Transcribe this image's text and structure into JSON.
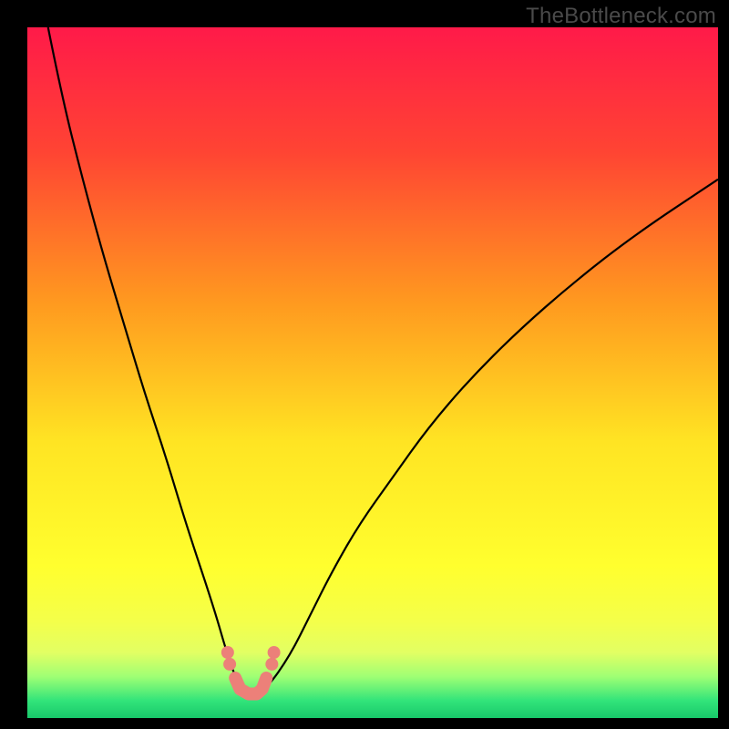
{
  "watermark": "TheBottleneck.com",
  "chart_data": {
    "type": "line",
    "title": "",
    "xlabel": "",
    "ylabel": "",
    "xlim": [
      0,
      100
    ],
    "ylim": [
      0,
      100
    ],
    "gradient_stops": [
      {
        "offset": 0,
        "color": "#ff1a49"
      },
      {
        "offset": 0.18,
        "color": "#ff4433"
      },
      {
        "offset": 0.4,
        "color": "#ff9a1f"
      },
      {
        "offset": 0.6,
        "color": "#ffe423"
      },
      {
        "offset": 0.78,
        "color": "#ffff2e"
      },
      {
        "offset": 0.86,
        "color": "#f4ff4a"
      },
      {
        "offset": 0.905,
        "color": "#e2ff63"
      },
      {
        "offset": 0.94,
        "color": "#9fff74"
      },
      {
        "offset": 0.975,
        "color": "#32e47a"
      },
      {
        "offset": 1.0,
        "color": "#18c86a"
      }
    ],
    "series": [
      {
        "name": "bottleneck-curve",
        "description": "Two-branch V curve; x is relative scale 0-100, y is bottleneck %",
        "x": [
          3,
          5,
          8,
          11,
          14,
          17,
          20,
          23,
          27,
          29,
          30.8,
          32.5,
          34.6,
          38,
          41,
          44,
          48,
          53,
          58,
          64,
          71,
          79,
          88,
          100
        ],
        "values": [
          100,
          90,
          78,
          67,
          57,
          47,
          38,
          28,
          16,
          9,
          4.2,
          3.5,
          4.2,
          9,
          15,
          21,
          28,
          35,
          42,
          49,
          56,
          63,
          70,
          78
        ]
      }
    ],
    "markers": {
      "description": "Salmon dot/segment overlay near valley bottom",
      "color": "#ec8079",
      "points": [
        {
          "x": 29.0,
          "y": 9.5
        },
        {
          "x": 29.3,
          "y": 7.8
        },
        {
          "x": 30.1,
          "y": 5.8
        },
        {
          "x": 30.8,
          "y": 4.2
        },
        {
          "x": 32.0,
          "y": 3.5
        },
        {
          "x": 33.2,
          "y": 3.5
        },
        {
          "x": 34.0,
          "y": 4.2
        },
        {
          "x": 34.6,
          "y": 5.8
        },
        {
          "x": 35.4,
          "y": 7.8
        },
        {
          "x": 35.7,
          "y": 9.5
        }
      ]
    }
  }
}
